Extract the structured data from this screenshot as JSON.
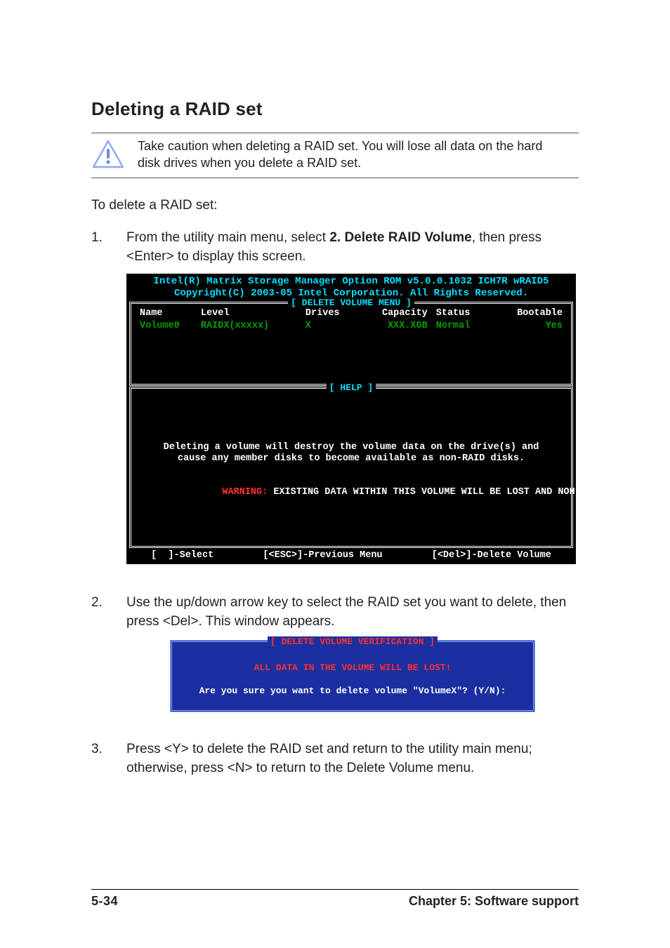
{
  "title": "Deleting a RAID set",
  "caution": "Take caution when deleting a RAID set. You will lose all data on the hard disk drives when you delete a RAID set.",
  "intro": "To delete a RAID set:",
  "steps": {
    "s1": {
      "num": "1.",
      "prefix": "From the utility main menu, select ",
      "bold": "2. Delete RAID Volume",
      "suffix": ", then press <Enter> to display this screen."
    },
    "s2": {
      "num": "2.",
      "text": "Use the up/down arrow key to select the RAID set you want to delete, then press <Del>. This window appears."
    },
    "s3": {
      "num": "3.",
      "text": "Press <Y> to delete the RAID set and return to the utility main menu; otherwise, press <N> to return to the Delete Volume menu."
    }
  },
  "rom": {
    "title1": "Intel(R) Matrix Storage Manager Option ROM v5.0.0.1032 ICH7R wRAID5",
    "title2": "Copyright(C) 2003-05 Intel Corporation. All Rights Reserved.",
    "box_delete_title": "[ DELETE VOLUME MENU ]",
    "headers": {
      "name": "Name",
      "level": "Level",
      "drives": "Drives",
      "capacity": "Capacity",
      "status": "Status",
      "bootable": "Bootable"
    },
    "row": {
      "name": "Volume0",
      "level": "RAIDX(xxxxx)",
      "drives": "X",
      "capacity": "XXX.XGB",
      "status": "Normal",
      "bootable": "Yes"
    },
    "box_help_title": "[ HELP ]",
    "help_line1": "Deleting a volume will destroy the volume data on the drive(s) and",
    "help_line2": "cause any member disks to become available as non-RAID disks.",
    "warn_label": "WARNING:",
    "warn_text": " EXISTING DATA WITHIN THIS VOLUME WILL BE LOST AND NON-RECOVERABLE.",
    "footer_select": "[  ]-Select",
    "footer_prev": "[<ESC>]-Previous Menu",
    "footer_del": "[<Del>]-Delete Volume"
  },
  "verify": {
    "title": "[ DELETE VOLUME VERIFICATION ]",
    "warn": "ALL DATA IN THE VOLUME WILL BE LOST!",
    "question": "Are you sure you want to delete volume \"VolumeX\"? (Y/N):"
  },
  "footer": {
    "page": "5-34",
    "chapter": "Chapter 5: Software support"
  }
}
